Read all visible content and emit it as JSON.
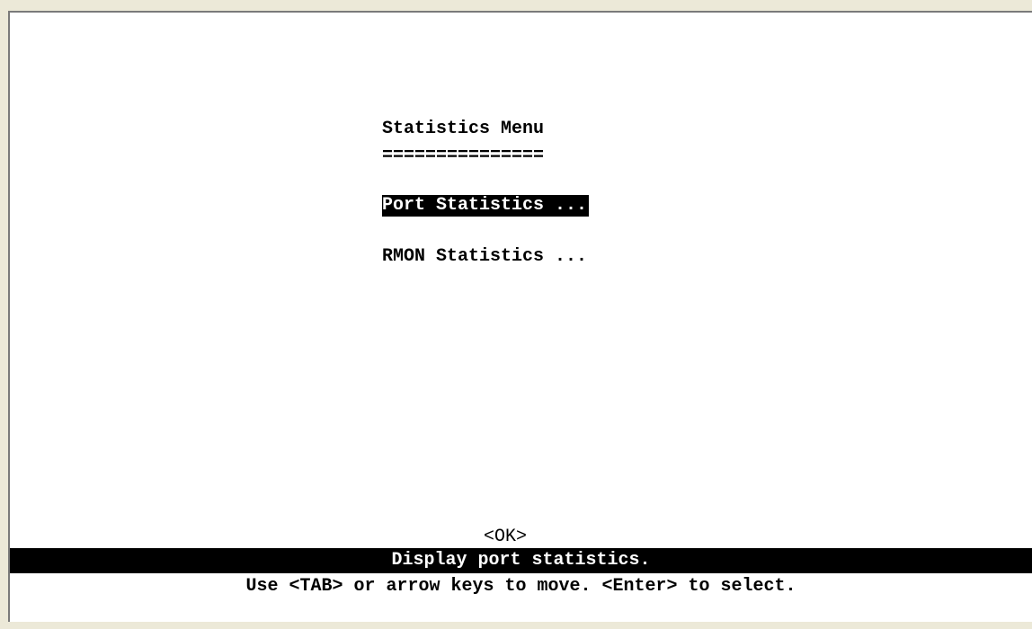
{
  "menu": {
    "title": "Statistics Menu",
    "underline": "===============",
    "items": [
      {
        "label": "Port Statistics ...",
        "selected": true
      },
      {
        "label": "RMON Statistics ...",
        "selected": false
      }
    ]
  },
  "ok_button": {
    "label": "<OK>"
  },
  "status_bar": {
    "text": "Display port statistics."
  },
  "hint": {
    "text": "Use <TAB> or arrow keys to move. <Enter> to select."
  }
}
